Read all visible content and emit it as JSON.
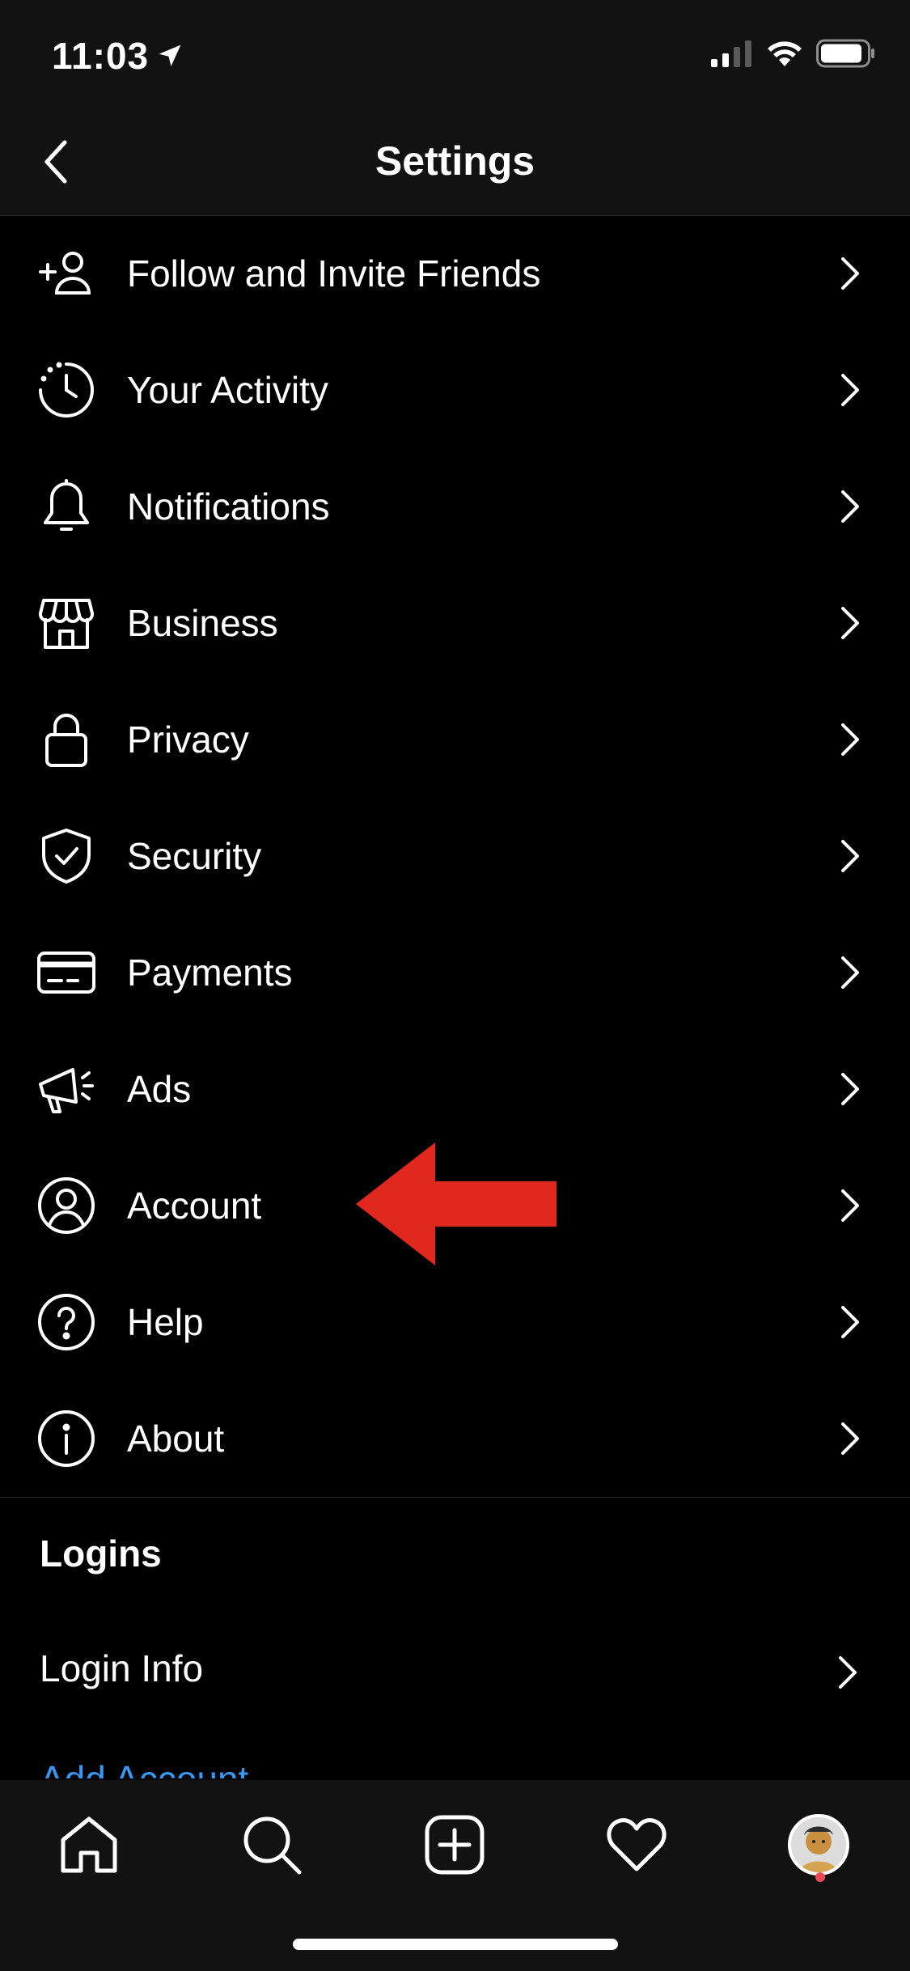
{
  "status_bar": {
    "time": "11:03"
  },
  "header": {
    "title": "Settings"
  },
  "menu": {
    "items": [
      {
        "label": "Follow and Invite Friends",
        "icon": "add-person-icon"
      },
      {
        "label": "Your Activity",
        "icon": "activity-clock-icon"
      },
      {
        "label": "Notifications",
        "icon": "bell-icon"
      },
      {
        "label": "Business",
        "icon": "storefront-icon"
      },
      {
        "label": "Privacy",
        "icon": "lock-icon"
      },
      {
        "label": "Security",
        "icon": "shield-check-icon"
      },
      {
        "label": "Payments",
        "icon": "credit-card-icon"
      },
      {
        "label": "Ads",
        "icon": "megaphone-icon"
      },
      {
        "label": "Account",
        "icon": "person-circle-icon"
      },
      {
        "label": "Help",
        "icon": "question-circle-icon"
      },
      {
        "label": "About",
        "icon": "info-circle-icon"
      }
    ]
  },
  "logins": {
    "section_title": "Logins",
    "login_info_label": "Login Info",
    "add_account_label": "Add Account"
  },
  "tab_bar": {
    "tabs": [
      "home-icon",
      "search-icon",
      "add-post-icon",
      "heart-icon",
      "profile-avatar"
    ]
  },
  "colors": {
    "background": "#000000",
    "bar_background": "#121212",
    "annotation_arrow": "#e0281f",
    "link_blue": "#3897f0",
    "notification_dot": "#ed4956"
  }
}
